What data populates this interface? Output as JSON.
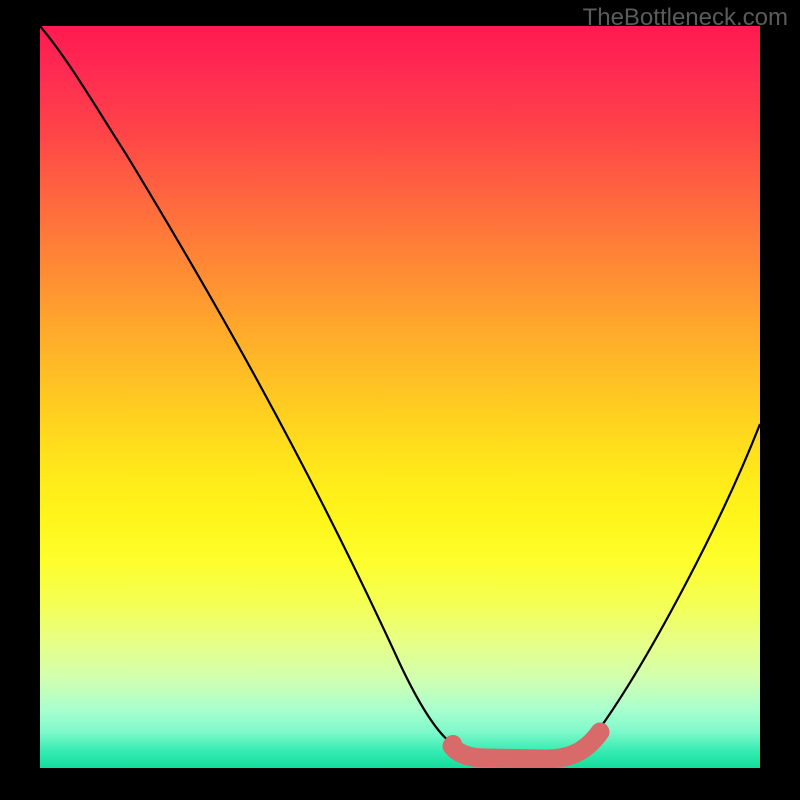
{
  "watermark": "TheBottleneck.com",
  "chart_data": {
    "type": "line",
    "title": "",
    "xlabel": "",
    "ylabel": "",
    "xlim": [
      0,
      100
    ],
    "ylim": [
      0,
      100
    ],
    "series": [
      {
        "name": "curve",
        "x": [
          0,
          6,
          12,
          18,
          24,
          30,
          36,
          42,
          48,
          54,
          58,
          62,
          66,
          70,
          74,
          78,
          82,
          86,
          90,
          94,
          98,
          100
        ],
        "y": [
          100,
          95,
          88.5,
          81,
          73,
          64.5,
          55.5,
          45.5,
          34,
          21.5,
          12,
          5,
          1.5,
          0.5,
          0.8,
          3,
          8,
          15,
          23,
          32,
          42,
          47
        ]
      }
    ],
    "highlight_zone": {
      "description": "flat valley segment rendered as thick pink band",
      "x_range": [
        57,
        78
      ],
      "approx_y": 1
    },
    "background_gradient": {
      "top": "#ff1a50",
      "mid": "#ffe81a",
      "bottom": "#14dd9a"
    }
  }
}
